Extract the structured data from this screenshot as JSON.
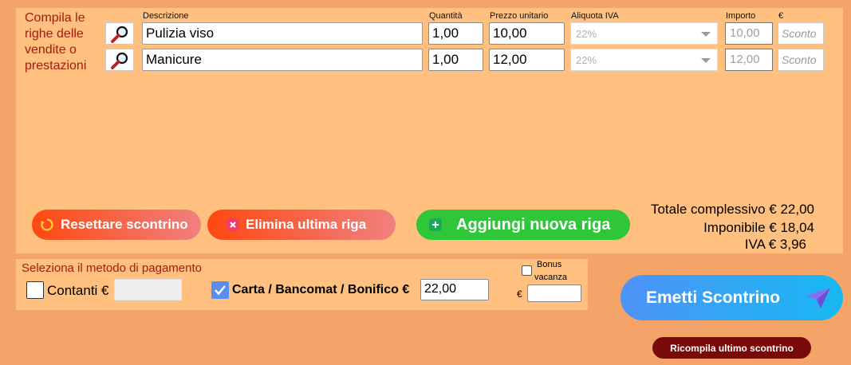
{
  "lines_panel": {
    "intro_text": "Compila le righe delle vendite o prestazioni",
    "columns": {
      "description": "Descrizione",
      "quantity": "Quantità",
      "unit_price": "Prezzo unitario",
      "vat_rate": "Aliquota IVA",
      "amount": "Importo",
      "currency": "€"
    },
    "rows": [
      {
        "description": "Pulizia viso",
        "quantity": "1,00",
        "unit_price": "10,00",
        "vat_rate": "22%",
        "amount": "10,00",
        "discount_placeholder": "Sconto"
      },
      {
        "description": "Manicure",
        "quantity": "1,00",
        "unit_price": "12,00",
        "vat_rate": "22%",
        "amount": "12,00",
        "discount_placeholder": "Sconto"
      }
    ]
  },
  "actions": {
    "reset_label": "Resettare scontrino",
    "delete_last_label": "Elimina ultima riga",
    "add_row_label": "Aggiungi nuova riga"
  },
  "totals": {
    "total_label": "Totale complessivo € 22,00",
    "taxable_label": "Imponibile € 18,04",
    "vat_label": "IVA € 3,96"
  },
  "payment": {
    "title": "Seleziona il metodo di pagamento",
    "cash_label": "Contanti €",
    "cash_value": "",
    "cash_checked": false,
    "card_label": "Carta / Bancomat / Bonifico €",
    "card_value": "22,00",
    "card_checked": true,
    "bonus_label_1": "Bonus",
    "bonus_label_2": "vacanza",
    "bonus_checked": false,
    "bonus_currency": "€",
    "bonus_value": ""
  },
  "emit_label": "Emetti Scontrino",
  "recompile_label": "Ricompila ultimo scontrino",
  "colors": {
    "background": "#f4a469",
    "panel": "#ffc080",
    "label_red": "#a11d0b",
    "green_button": "#2fc63a",
    "checkbox_blue": "#5b8def",
    "recompile_bg": "#7a0a0a"
  }
}
